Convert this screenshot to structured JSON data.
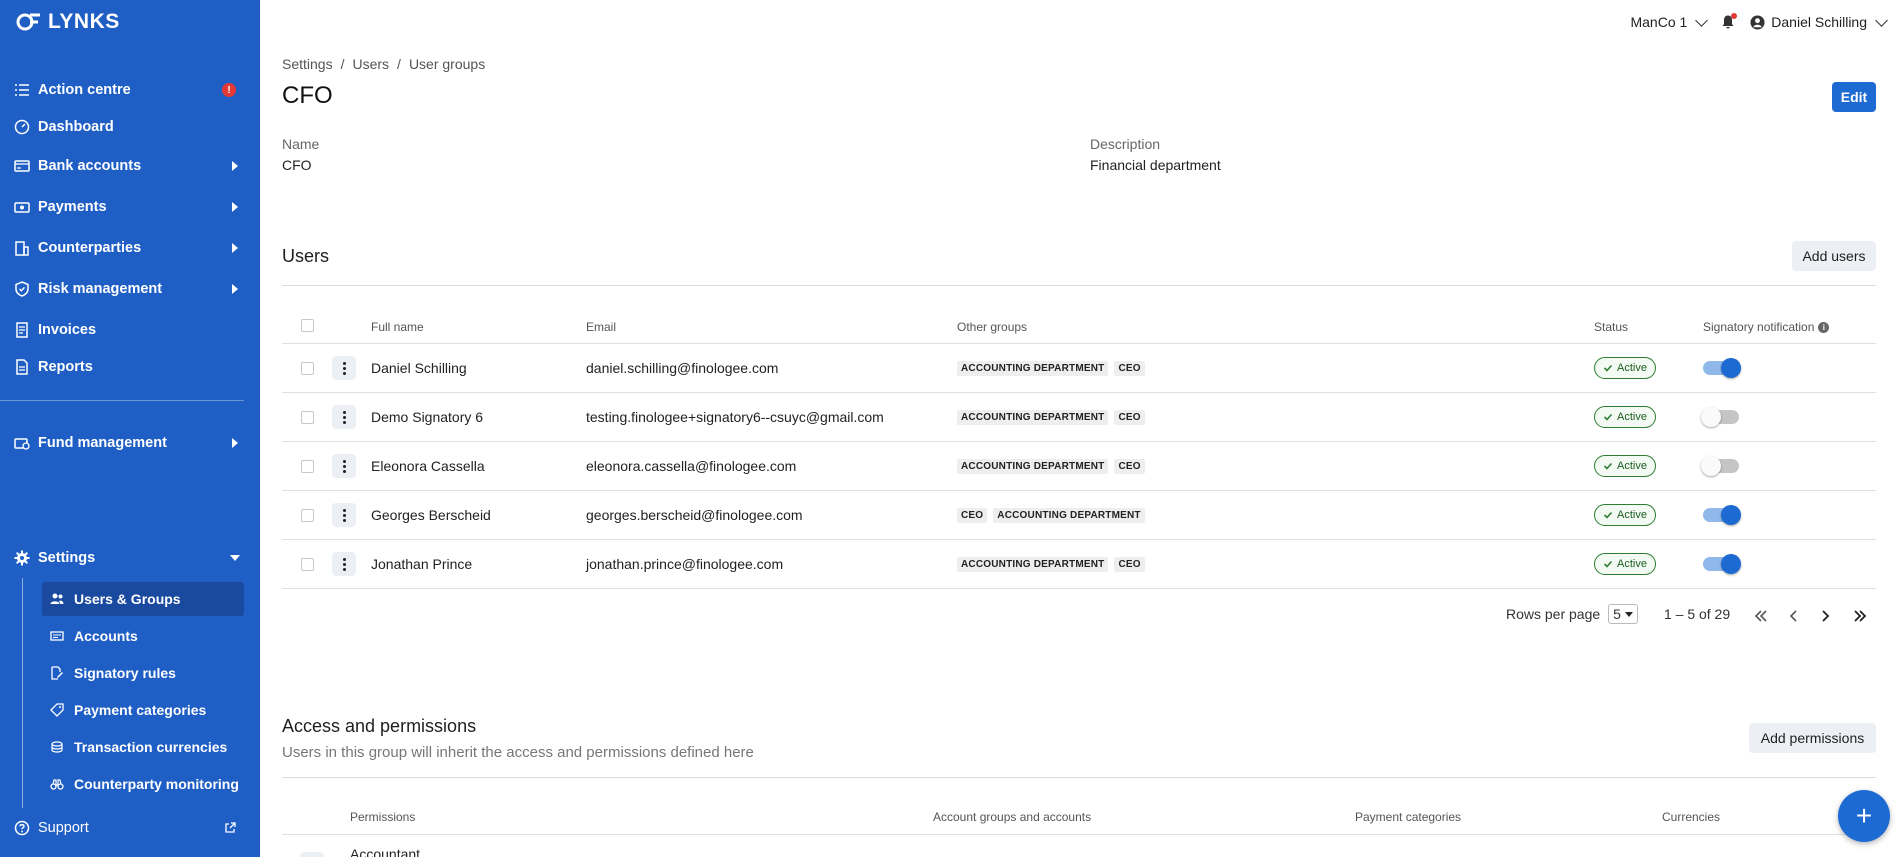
{
  "brand": {
    "name": "LYNKS"
  },
  "sidebar": {
    "items": [
      {
        "label": "Action centre",
        "icon": "list-check-icon",
        "badge": "!"
      },
      {
        "label": "Dashboard",
        "icon": "gauge-icon"
      },
      {
        "label": "Bank accounts",
        "icon": "bank-card-icon"
      },
      {
        "label": "Payments",
        "icon": "money-icon"
      },
      {
        "label": "Counterparties",
        "icon": "building-icon"
      },
      {
        "label": "Risk management",
        "icon": "shield-icon"
      },
      {
        "label": "Invoices",
        "icon": "invoice-icon"
      },
      {
        "label": "Reports",
        "icon": "report-icon"
      },
      {
        "label": "Fund management",
        "icon": "fund-icon"
      },
      {
        "label": "Settings",
        "icon": "gear-icon"
      },
      {
        "label": "Support",
        "icon": "help-icon"
      }
    ],
    "settings_sub": [
      {
        "label": "Users & Groups",
        "icon": "users-icon"
      },
      {
        "label": "Accounts",
        "icon": "accounts-icon"
      },
      {
        "label": "Signatory rules",
        "icon": "signature-icon"
      },
      {
        "label": "Payment categories",
        "icon": "tag-icon"
      },
      {
        "label": "Transaction currencies",
        "icon": "coins-icon"
      },
      {
        "label": "Counterparty monitoring",
        "icon": "binoculars-icon"
      }
    ]
  },
  "topbar": {
    "entity": "ManCo 1",
    "user": "Daniel Schilling"
  },
  "breadcrumb": [
    "Settings",
    "/",
    "Users",
    "/",
    "User groups"
  ],
  "page": {
    "title": "CFO",
    "edit_label": "Edit",
    "name_label": "Name",
    "name_value": "CFO",
    "description_label": "Description",
    "description_value": "Financial department"
  },
  "users_section": {
    "title": "Users",
    "add_label": "Add users",
    "columns": [
      "Full name",
      "Email",
      "Other groups",
      "Status",
      "Signatory notification"
    ],
    "rows": [
      {
        "name": "Daniel Schilling",
        "email": "daniel.schilling@finologee.com",
        "groups": [
          "ACCOUNTING DEPARTMENT",
          "CEO"
        ],
        "status": "Active",
        "notify": true
      },
      {
        "name": "Demo Signatory 6",
        "email": "testing.finologee+signatory6--csuyc@gmail.com",
        "groups": [
          "ACCOUNTING DEPARTMENT",
          "CEO"
        ],
        "status": "Active",
        "notify": false
      },
      {
        "name": "Eleonora Cassella",
        "email": "eleonora.cassella@finologee.com",
        "groups": [
          "ACCOUNTING DEPARTMENT",
          "CEO"
        ],
        "status": "Active",
        "notify": false
      },
      {
        "name": "Georges Berscheid",
        "email": "georges.berscheid@finologee.com",
        "groups": [
          "CEO",
          "ACCOUNTING DEPARTMENT"
        ],
        "status": "Active",
        "notify": true
      },
      {
        "name": "Jonathan Prince",
        "email": "jonathan.prince@finologee.com",
        "groups": [
          "ACCOUNTING DEPARTMENT",
          "CEO"
        ],
        "status": "Active",
        "notify": true
      }
    ],
    "pagination": {
      "rows_per_page_label": "Rows per page",
      "rows_per_page": "5",
      "range": "1 – 5 of 29"
    }
  },
  "access_section": {
    "title": "Access and permissions",
    "subtitle": "Users in this group will inherit the access and permissions defined here",
    "add_label": "Add permissions",
    "columns": [
      "Permissions",
      "Account groups and accounts",
      "Payment categories",
      "Currencies"
    ],
    "first_row": "Accountant"
  },
  "fab": {
    "label": "+"
  },
  "colors": {
    "sidebar": "#1f5fc5",
    "primary": "#1d6ad2",
    "active_green": "#2e7d32",
    "alert": "#e53935"
  }
}
